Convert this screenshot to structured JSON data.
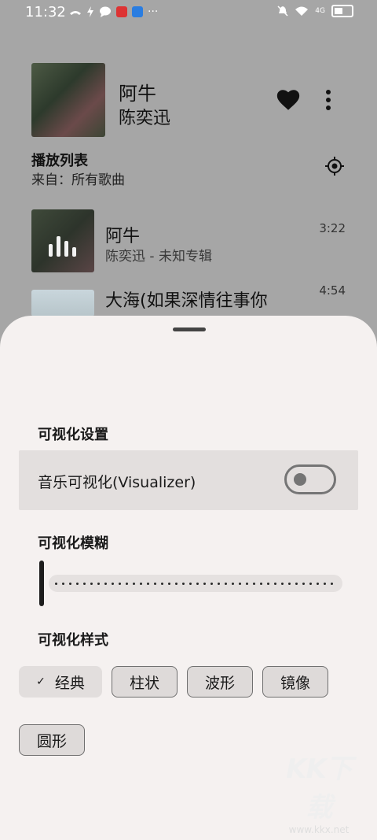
{
  "status_bar": {
    "time": "11:32",
    "left_icons": [
      "missed-call-icon",
      "flash-icon",
      "message-icon",
      "app-badge-icon",
      "app-badge-blue-icon",
      "ellipsis-icon"
    ],
    "right_icons": [
      "mute-icon",
      "wifi-icon",
      "signal-4g-icon",
      "battery-icon"
    ],
    "signal_label": "4G"
  },
  "now_playing": {
    "title": "阿牛",
    "artist": "陈奕迅",
    "icons": [
      "heart-icon",
      "more-vert-icon"
    ]
  },
  "playlist": {
    "title": "播放列表",
    "source": "来自：所有歌曲"
  },
  "songs": [
    {
      "title": "阿牛",
      "subtitle": "陈奕迅 - 未知专辑",
      "duration": "3:22"
    },
    {
      "title": "大海(如果深情往事你",
      "subtitle": "",
      "duration": "4:54"
    }
  ],
  "sheet": {
    "visualization_header": "可视化设置",
    "visualizer_label": "音乐可视化(Visualizer)",
    "visualizer_enabled": false,
    "blur_header": "可视化模糊",
    "blur_value": 0,
    "style_header": "可视化样式",
    "styles": [
      "经典",
      "柱状",
      "波形",
      "镜像",
      "圆形"
    ],
    "selected_style": "经典",
    "check_glyph": "✓"
  },
  "watermark": {
    "logo": "KK下载",
    "url": "www.kkx.net"
  }
}
